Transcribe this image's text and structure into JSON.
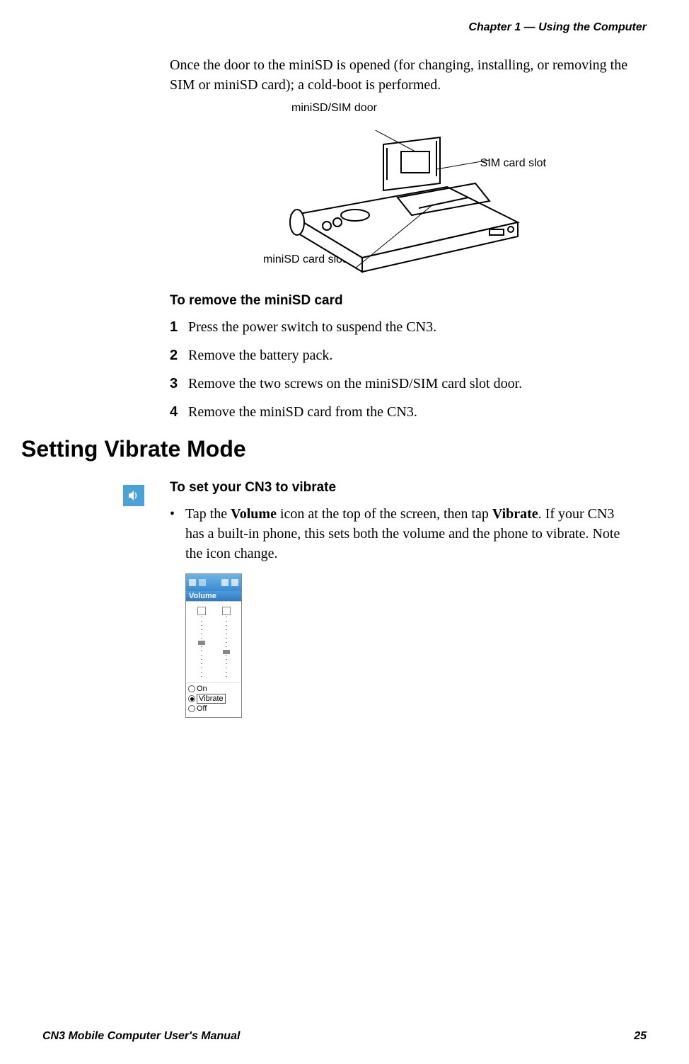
{
  "header": {
    "chapter_line": "Chapter 1 —  Using the Computer"
  },
  "intro_paragraph": "Once the door to the miniSD is opened (for changing, installing, or removing the SIM or miniSD card); a cold-boot is performed.",
  "diagram": {
    "label_top": "miniSD/SIM door",
    "label_right": "SIM card slot",
    "label_bottom": "miniSD card slot"
  },
  "remove_section": {
    "heading": "To remove the miniSD card",
    "steps": [
      "Press the power switch to suspend the CN3.",
      "Remove the battery pack.",
      "Remove the two screws on the miniSD/SIM card slot door.",
      "Remove the miniSD card from the CN3."
    ]
  },
  "section_heading": "Setting Vibrate Mode",
  "vibrate_section": {
    "heading": "To set your CN3 to vibrate",
    "bullet_prefix": "Tap the ",
    "bullet_bold1": "Volume",
    "bullet_mid1": " icon at the top of the screen, then tap ",
    "bullet_bold2": "Vibrate",
    "bullet_suffix": ". If your CN3 has a built-in phone, this sets both the volume and the phone to vibrate. Note the icon change."
  },
  "screenshot": {
    "panel_title": "Volume",
    "options": {
      "on": "On",
      "vibrate": "Vibrate",
      "off": "Off"
    }
  },
  "footer": {
    "left": "CN3 Mobile Computer User's Manual",
    "right": "25"
  }
}
